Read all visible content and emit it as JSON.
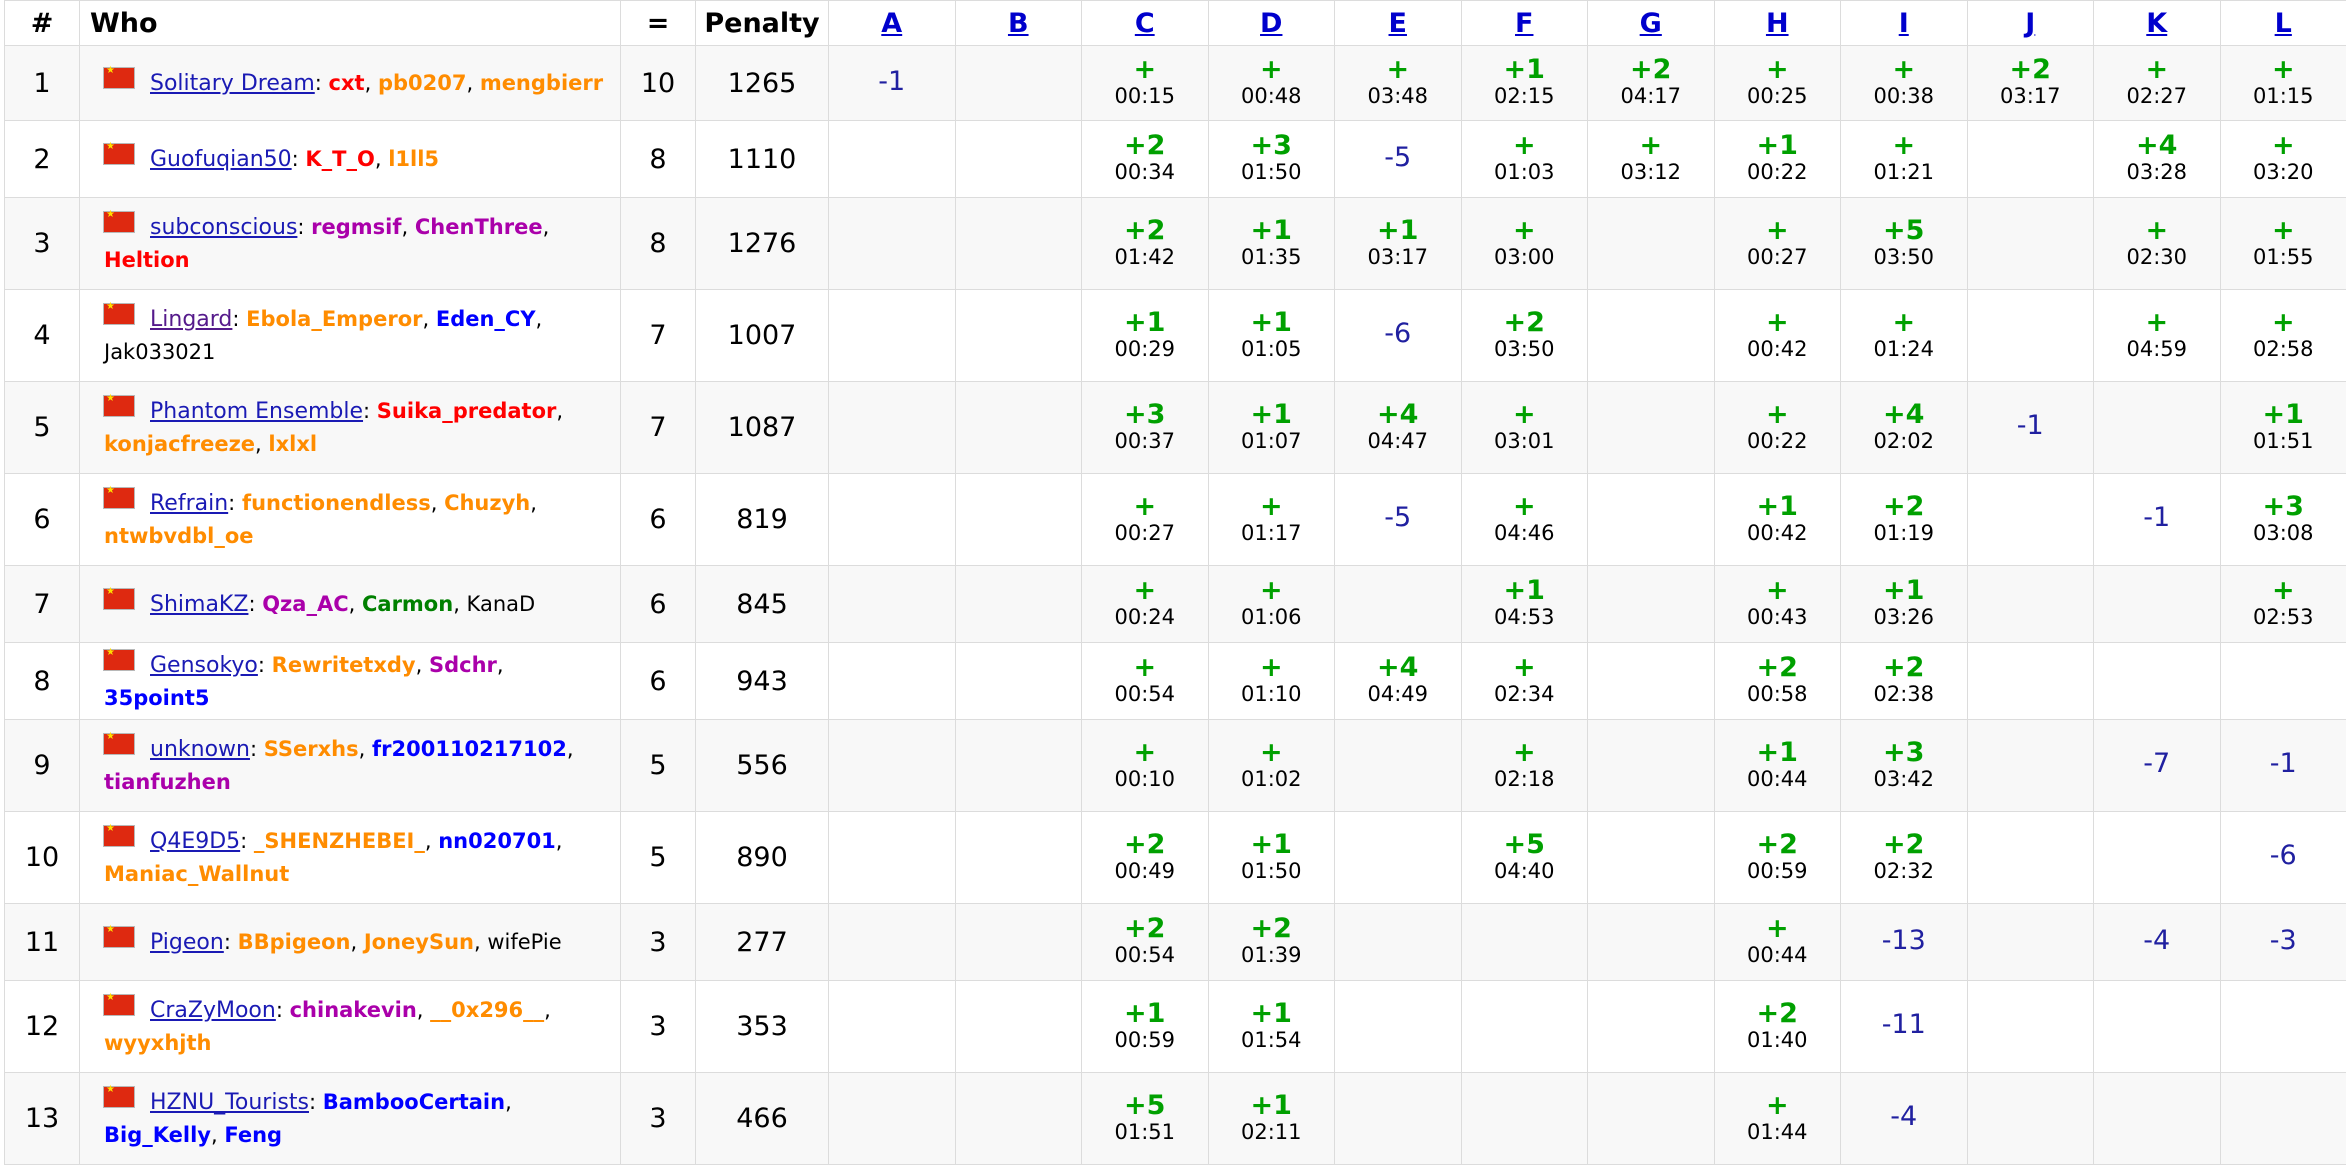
{
  "headers": {
    "rank": "#",
    "who": "Who",
    "solved": "=",
    "penalty": "Penalty",
    "problems": [
      "A",
      "B",
      "C",
      "D",
      "E",
      "F",
      "G",
      "H",
      "I",
      "J",
      "K",
      "L"
    ]
  },
  "rows": [
    {
      "rank": "1",
      "team": "Solitary Dream",
      "team_visited": false,
      "members": [
        {
          "name": "cxt",
          "color": "red"
        },
        {
          "name": "pb0207",
          "color": "orange"
        },
        {
          "name": "mengbierr",
          "color": "orange"
        }
      ],
      "solved": "10",
      "penalty": "1265",
      "cells": [
        {
          "r": "-1"
        },
        {},
        {
          "a": "+",
          "t": "00:15"
        },
        {
          "a": "+",
          "t": "00:48"
        },
        {
          "a": "+",
          "t": "03:48"
        },
        {
          "a": "+1",
          "t": "02:15"
        },
        {
          "a": "+2",
          "t": "04:17"
        },
        {
          "a": "+",
          "t": "00:25"
        },
        {
          "a": "+",
          "t": "00:38"
        },
        {
          "a": "+2",
          "t": "03:17"
        },
        {
          "a": "+",
          "t": "02:27"
        },
        {
          "a": "+",
          "t": "01:15"
        }
      ]
    },
    {
      "rank": "2",
      "team": "Guofuqian50",
      "team_visited": false,
      "members": [
        {
          "name": "K_T_O",
          "color": "red"
        },
        {
          "name": "l1ll5",
          "color": "orange"
        }
      ],
      "solved": "8",
      "penalty": "1110",
      "cells": [
        {},
        {},
        {
          "a": "+2",
          "t": "00:34"
        },
        {
          "a": "+3",
          "t": "01:50"
        },
        {
          "r": "-5"
        },
        {
          "a": "+",
          "t": "01:03"
        },
        {
          "a": "+",
          "t": "03:12"
        },
        {
          "a": "+1",
          "t": "00:22"
        },
        {
          "a": "+",
          "t": "01:21"
        },
        {},
        {
          "a": "+4",
          "t": "03:28"
        },
        {
          "a": "+",
          "t": "03:20"
        }
      ]
    },
    {
      "rank": "3",
      "team": "subconscious",
      "team_visited": false,
      "members": [
        {
          "name": "regmsif",
          "color": "violet"
        },
        {
          "name": "ChenThree",
          "color": "violet"
        },
        {
          "name": "Heltion",
          "color": "red"
        }
      ],
      "solved": "8",
      "penalty": "1276",
      "cells": [
        {},
        {},
        {
          "a": "+2",
          "t": "01:42"
        },
        {
          "a": "+1",
          "t": "01:35"
        },
        {
          "a": "+1",
          "t": "03:17"
        },
        {
          "a": "+",
          "t": "03:00"
        },
        {},
        {
          "a": "+",
          "t": "00:27"
        },
        {
          "a": "+5",
          "t": "03:50"
        },
        {},
        {
          "a": "+",
          "t": "02:30"
        },
        {
          "a": "+",
          "t": "01:55"
        }
      ]
    },
    {
      "rank": "4",
      "team": "Lingard",
      "team_visited": true,
      "members": [
        {
          "name": "Ebola_Emperor",
          "color": "orange"
        },
        {
          "name": "Eden_CY",
          "color": "blue"
        },
        {
          "name": "Jak033021",
          "color": "black"
        }
      ],
      "solved": "7",
      "penalty": "1007",
      "cells": [
        {},
        {},
        {
          "a": "+1",
          "t": "00:29"
        },
        {
          "a": "+1",
          "t": "01:05"
        },
        {
          "r": "-6"
        },
        {
          "a": "+2",
          "t": "03:50"
        },
        {},
        {
          "a": "+",
          "t": "00:42"
        },
        {
          "a": "+",
          "t": "01:24"
        },
        {},
        {
          "a": "+",
          "t": "04:59"
        },
        {
          "a": "+",
          "t": "02:58"
        }
      ]
    },
    {
      "rank": "5",
      "team": "Phantom Ensemble",
      "team_visited": false,
      "members": [
        {
          "name": "Suika_predator",
          "color": "red"
        },
        {
          "name": "konjacfreeze",
          "color": "orange"
        },
        {
          "name": "lxlxl",
          "color": "orange"
        }
      ],
      "solved": "7",
      "penalty": "1087",
      "cells": [
        {},
        {},
        {
          "a": "+3",
          "t": "00:37"
        },
        {
          "a": "+1",
          "t": "01:07"
        },
        {
          "a": "+4",
          "t": "04:47"
        },
        {
          "a": "+",
          "t": "03:01"
        },
        {},
        {
          "a": "+",
          "t": "00:22"
        },
        {
          "a": "+4",
          "t": "02:02"
        },
        {
          "r": "-1"
        },
        {},
        {
          "a": "+1",
          "t": "01:51"
        }
      ]
    },
    {
      "rank": "6",
      "team": "Refrain",
      "team_visited": false,
      "members": [
        {
          "name": "functionendless",
          "color": "orange"
        },
        {
          "name": "Chuzyh",
          "color": "orange"
        },
        {
          "name": "ntwbvdbl_oe",
          "color": "orange"
        }
      ],
      "solved": "6",
      "penalty": "819",
      "cells": [
        {},
        {},
        {
          "a": "+",
          "t": "00:27"
        },
        {
          "a": "+",
          "t": "01:17"
        },
        {
          "r": "-5"
        },
        {
          "a": "+",
          "t": "04:46"
        },
        {},
        {
          "a": "+1",
          "t": "00:42"
        },
        {
          "a": "+2",
          "t": "01:19"
        },
        {},
        {
          "r": "-1"
        },
        {
          "a": "+3",
          "t": "03:08"
        }
      ]
    },
    {
      "rank": "7",
      "team": "ShimaKZ",
      "team_visited": false,
      "members": [
        {
          "name": "Qza_AC",
          "color": "violet"
        },
        {
          "name": "Carmon",
          "color": "green"
        },
        {
          "name": "KanaD",
          "color": "black"
        }
      ],
      "solved": "6",
      "penalty": "845",
      "cells": [
        {},
        {},
        {
          "a": "+",
          "t": "00:24"
        },
        {
          "a": "+",
          "t": "01:06"
        },
        {},
        {
          "a": "+1",
          "t": "04:53"
        },
        {},
        {
          "a": "+",
          "t": "00:43"
        },
        {
          "a": "+1",
          "t": "03:26"
        },
        {},
        {},
        {
          "a": "+",
          "t": "02:53"
        }
      ]
    },
    {
      "rank": "8",
      "team": "Gensokyo",
      "team_visited": false,
      "members": [
        {
          "name": "Rewritetxdy",
          "color": "orange"
        },
        {
          "name": "Sdchr",
          "color": "violet"
        },
        {
          "name": "35point5",
          "color": "blue"
        }
      ],
      "solved": "6",
      "penalty": "943",
      "cells": [
        {},
        {},
        {
          "a": "+",
          "t": "00:54"
        },
        {
          "a": "+",
          "t": "01:10"
        },
        {
          "a": "+4",
          "t": "04:49"
        },
        {
          "a": "+",
          "t": "02:34"
        },
        {},
        {
          "a": "+2",
          "t": "00:58"
        },
        {
          "a": "+2",
          "t": "02:38"
        },
        {},
        {},
        {}
      ]
    },
    {
      "rank": "9",
      "team": "unknown",
      "team_visited": false,
      "members": [
        {
          "name": "SSerxhs",
          "color": "orange"
        },
        {
          "name": "fr200110217102",
          "color": "blue"
        },
        {
          "name": "tianfuzhen",
          "color": "violet"
        }
      ],
      "solved": "5",
      "penalty": "556",
      "cells": [
        {},
        {},
        {
          "a": "+",
          "t": "00:10"
        },
        {
          "a": "+",
          "t": "01:02"
        },
        {},
        {
          "a": "+",
          "t": "02:18"
        },
        {},
        {
          "a": "+1",
          "t": "00:44"
        },
        {
          "a": "+3",
          "t": "03:42"
        },
        {},
        {
          "r": "-7"
        },
        {
          "r": "-1"
        }
      ]
    },
    {
      "rank": "10",
      "team": "Q4E9D5",
      "team_visited": false,
      "members": [
        {
          "name": "_SHENZHEBEI_",
          "color": "orange"
        },
        {
          "name": "nn020701",
          "color": "blue"
        },
        {
          "name": "Maniac_Wallnut",
          "color": "orange"
        }
      ],
      "solved": "5",
      "penalty": "890",
      "cells": [
        {},
        {},
        {
          "a": "+2",
          "t": "00:49"
        },
        {
          "a": "+1",
          "t": "01:50"
        },
        {},
        {
          "a": "+5",
          "t": "04:40"
        },
        {},
        {
          "a": "+2",
          "t": "00:59"
        },
        {
          "a": "+2",
          "t": "02:32"
        },
        {},
        {},
        {
          "r": "-6"
        }
      ]
    },
    {
      "rank": "11",
      "team": "Pigeon",
      "team_visited": false,
      "members": [
        {
          "name": "BBpigeon",
          "color": "orange"
        },
        {
          "name": "JoneySun",
          "color": "orange"
        },
        {
          "name": "wifePie",
          "color": "black"
        }
      ],
      "solved": "3",
      "penalty": "277",
      "cells": [
        {},
        {},
        {
          "a": "+2",
          "t": "00:54"
        },
        {
          "a": "+2",
          "t": "01:39"
        },
        {},
        {},
        {},
        {
          "a": "+",
          "t": "00:44"
        },
        {
          "r": "-13"
        },
        {},
        {
          "r": "-4"
        },
        {
          "r": "-3"
        }
      ]
    },
    {
      "rank": "12",
      "team": "CraZyMoon",
      "team_visited": false,
      "members": [
        {
          "name": "chinakevin",
          "color": "violet"
        },
        {
          "name": "__0x296__",
          "color": "orange"
        },
        {
          "name": "wyyxhjth",
          "color": "orange"
        }
      ],
      "solved": "3",
      "penalty": "353",
      "cells": [
        {},
        {},
        {
          "a": "+1",
          "t": "00:59"
        },
        {
          "a": "+1",
          "t": "01:54"
        },
        {},
        {},
        {},
        {
          "a": "+2",
          "t": "01:40"
        },
        {
          "r": "-11"
        },
        {},
        {},
        {}
      ]
    },
    {
      "rank": "13",
      "team": "HZNU_Tourists",
      "team_visited": false,
      "members": [
        {
          "name": "BambooCertain",
          "color": "blue"
        },
        {
          "name": "Big_Kelly",
          "color": "blue"
        },
        {
          "name": "Feng",
          "color": "blue"
        }
      ],
      "solved": "3",
      "penalty": "466",
      "cells": [
        {},
        {},
        {
          "a": "+5",
          "t": "01:51"
        },
        {
          "a": "+1",
          "t": "02:11"
        },
        {},
        {},
        {},
        {
          "a": "+",
          "t": "01:44"
        },
        {
          "r": "-4"
        },
        {},
        {},
        {}
      ]
    }
  ]
}
